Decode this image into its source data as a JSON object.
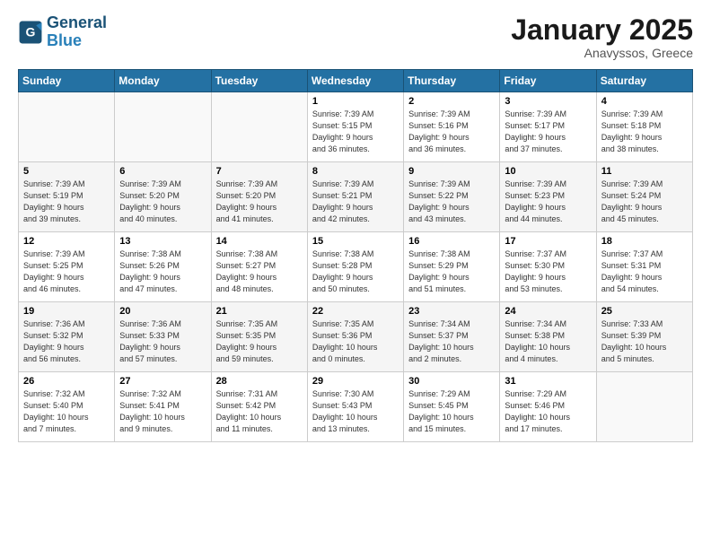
{
  "logo": {
    "line1": "General",
    "line2": "Blue"
  },
  "title": "January 2025",
  "subtitle": "Anavyssos, Greece",
  "days_header": [
    "Sunday",
    "Monday",
    "Tuesday",
    "Wednesday",
    "Thursday",
    "Friday",
    "Saturday"
  ],
  "weeks": [
    [
      {
        "num": "",
        "info": ""
      },
      {
        "num": "",
        "info": ""
      },
      {
        "num": "",
        "info": ""
      },
      {
        "num": "1",
        "info": "Sunrise: 7:39 AM\nSunset: 5:15 PM\nDaylight: 9 hours\nand 36 minutes."
      },
      {
        "num": "2",
        "info": "Sunrise: 7:39 AM\nSunset: 5:16 PM\nDaylight: 9 hours\nand 36 minutes."
      },
      {
        "num": "3",
        "info": "Sunrise: 7:39 AM\nSunset: 5:17 PM\nDaylight: 9 hours\nand 37 minutes."
      },
      {
        "num": "4",
        "info": "Sunrise: 7:39 AM\nSunset: 5:18 PM\nDaylight: 9 hours\nand 38 minutes."
      }
    ],
    [
      {
        "num": "5",
        "info": "Sunrise: 7:39 AM\nSunset: 5:19 PM\nDaylight: 9 hours\nand 39 minutes."
      },
      {
        "num": "6",
        "info": "Sunrise: 7:39 AM\nSunset: 5:20 PM\nDaylight: 9 hours\nand 40 minutes."
      },
      {
        "num": "7",
        "info": "Sunrise: 7:39 AM\nSunset: 5:20 PM\nDaylight: 9 hours\nand 41 minutes."
      },
      {
        "num": "8",
        "info": "Sunrise: 7:39 AM\nSunset: 5:21 PM\nDaylight: 9 hours\nand 42 minutes."
      },
      {
        "num": "9",
        "info": "Sunrise: 7:39 AM\nSunset: 5:22 PM\nDaylight: 9 hours\nand 43 minutes."
      },
      {
        "num": "10",
        "info": "Sunrise: 7:39 AM\nSunset: 5:23 PM\nDaylight: 9 hours\nand 44 minutes."
      },
      {
        "num": "11",
        "info": "Sunrise: 7:39 AM\nSunset: 5:24 PM\nDaylight: 9 hours\nand 45 minutes."
      }
    ],
    [
      {
        "num": "12",
        "info": "Sunrise: 7:39 AM\nSunset: 5:25 PM\nDaylight: 9 hours\nand 46 minutes."
      },
      {
        "num": "13",
        "info": "Sunrise: 7:38 AM\nSunset: 5:26 PM\nDaylight: 9 hours\nand 47 minutes."
      },
      {
        "num": "14",
        "info": "Sunrise: 7:38 AM\nSunset: 5:27 PM\nDaylight: 9 hours\nand 48 minutes."
      },
      {
        "num": "15",
        "info": "Sunrise: 7:38 AM\nSunset: 5:28 PM\nDaylight: 9 hours\nand 50 minutes."
      },
      {
        "num": "16",
        "info": "Sunrise: 7:38 AM\nSunset: 5:29 PM\nDaylight: 9 hours\nand 51 minutes."
      },
      {
        "num": "17",
        "info": "Sunrise: 7:37 AM\nSunset: 5:30 PM\nDaylight: 9 hours\nand 53 minutes."
      },
      {
        "num": "18",
        "info": "Sunrise: 7:37 AM\nSunset: 5:31 PM\nDaylight: 9 hours\nand 54 minutes."
      }
    ],
    [
      {
        "num": "19",
        "info": "Sunrise: 7:36 AM\nSunset: 5:32 PM\nDaylight: 9 hours\nand 56 minutes."
      },
      {
        "num": "20",
        "info": "Sunrise: 7:36 AM\nSunset: 5:33 PM\nDaylight: 9 hours\nand 57 minutes."
      },
      {
        "num": "21",
        "info": "Sunrise: 7:35 AM\nSunset: 5:35 PM\nDaylight: 9 hours\nand 59 minutes."
      },
      {
        "num": "22",
        "info": "Sunrise: 7:35 AM\nSunset: 5:36 PM\nDaylight: 10 hours\nand 0 minutes."
      },
      {
        "num": "23",
        "info": "Sunrise: 7:34 AM\nSunset: 5:37 PM\nDaylight: 10 hours\nand 2 minutes."
      },
      {
        "num": "24",
        "info": "Sunrise: 7:34 AM\nSunset: 5:38 PM\nDaylight: 10 hours\nand 4 minutes."
      },
      {
        "num": "25",
        "info": "Sunrise: 7:33 AM\nSunset: 5:39 PM\nDaylight: 10 hours\nand 5 minutes."
      }
    ],
    [
      {
        "num": "26",
        "info": "Sunrise: 7:32 AM\nSunset: 5:40 PM\nDaylight: 10 hours\nand 7 minutes."
      },
      {
        "num": "27",
        "info": "Sunrise: 7:32 AM\nSunset: 5:41 PM\nDaylight: 10 hours\nand 9 minutes."
      },
      {
        "num": "28",
        "info": "Sunrise: 7:31 AM\nSunset: 5:42 PM\nDaylight: 10 hours\nand 11 minutes."
      },
      {
        "num": "29",
        "info": "Sunrise: 7:30 AM\nSunset: 5:43 PM\nDaylight: 10 hours\nand 13 minutes."
      },
      {
        "num": "30",
        "info": "Sunrise: 7:29 AM\nSunset: 5:45 PM\nDaylight: 10 hours\nand 15 minutes."
      },
      {
        "num": "31",
        "info": "Sunrise: 7:29 AM\nSunset: 5:46 PM\nDaylight: 10 hours\nand 17 minutes."
      },
      {
        "num": "",
        "info": ""
      }
    ]
  ]
}
